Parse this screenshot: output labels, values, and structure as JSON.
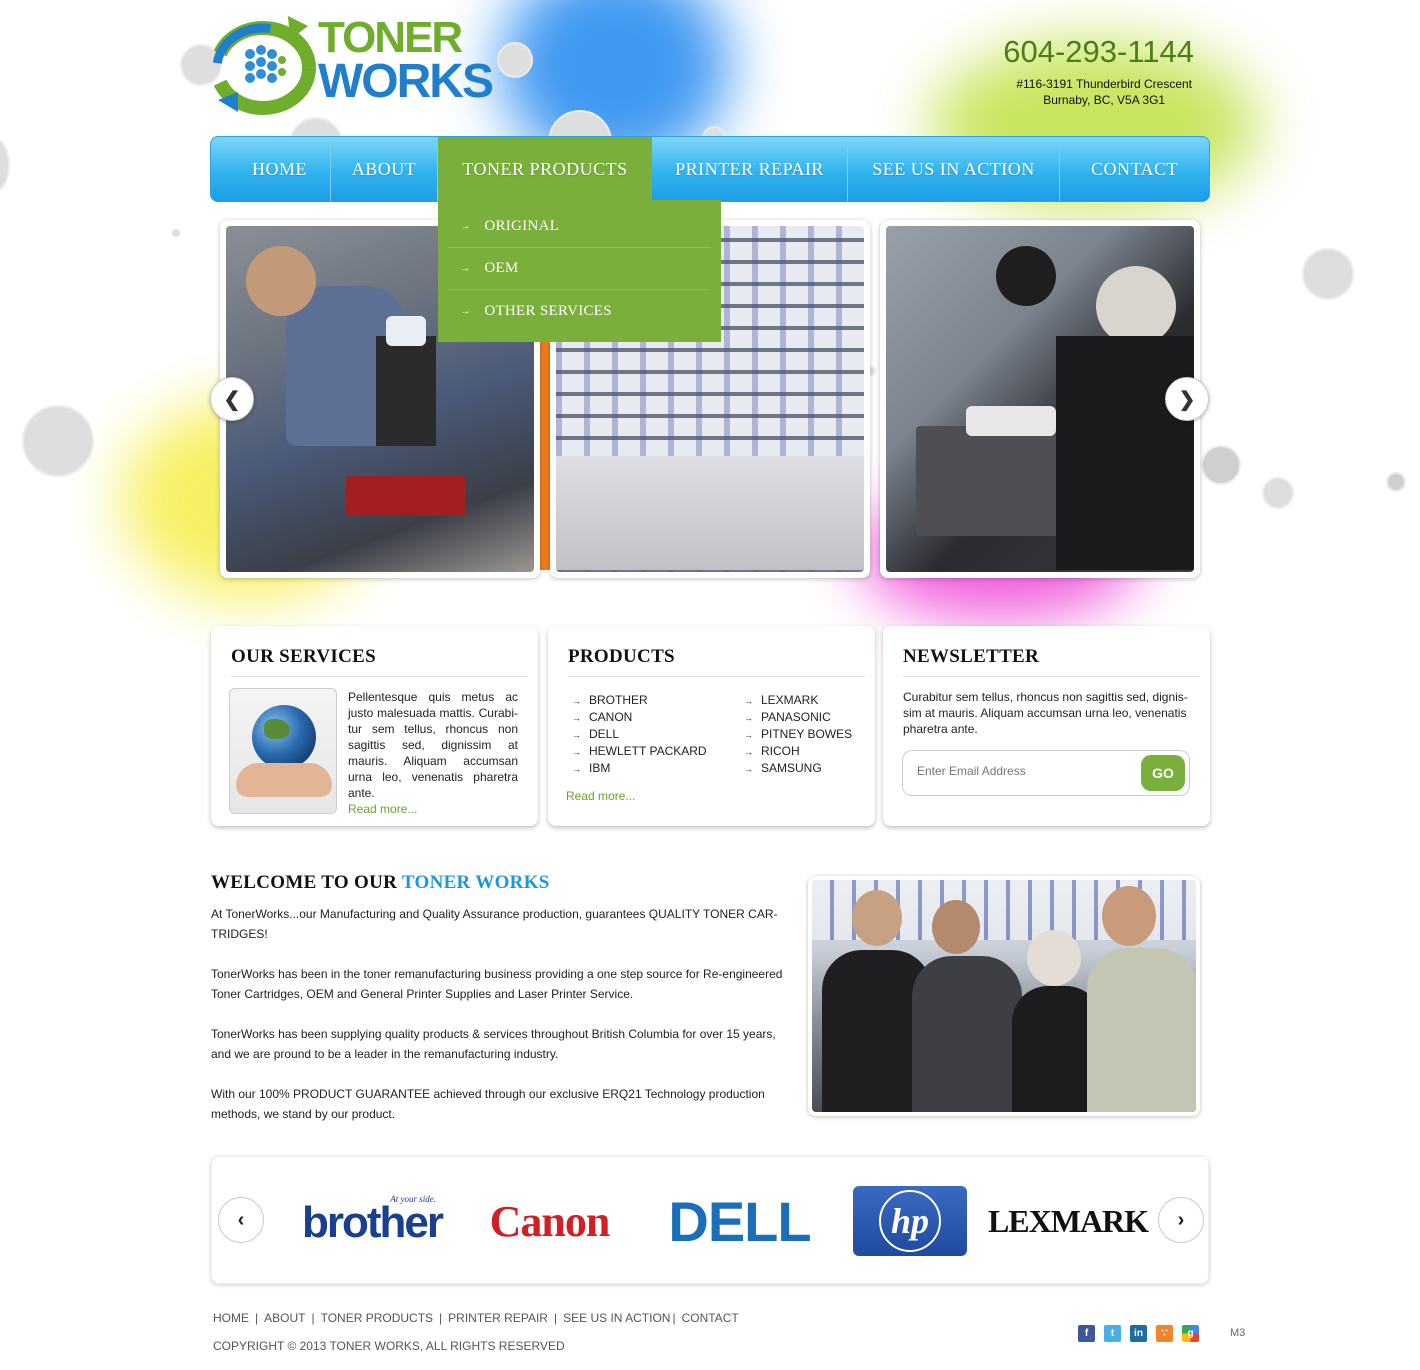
{
  "header": {
    "logo": {
      "line1": "TONER",
      "line2": "WORKS"
    },
    "phone": "604-293-1144",
    "address_line1": "#116-3191 Thunderbird Crescent",
    "address_line2": "Burnaby, BC, V5A 3G1"
  },
  "nav": {
    "items": [
      "HOME",
      "ABOUT",
      "TONER PRODUCTS",
      "PRINTER REPAIR",
      "SEE US IN ACTION",
      "CONTACT"
    ],
    "active": "TONER PRODUCTS",
    "dropdown": [
      "ORIGINAL",
      "OEM",
      "OTHER SERVICES"
    ]
  },
  "services": {
    "title": "OUR SERVICES",
    "text": "Pellentesque quis metus ac justo malesuada mattis. Curabi-tur sem tellus, rhoncus non sagittis sed, dignissim at mauris. Aliquam accumsan urna leo, venenatis pharetra ante.",
    "read_more": "Read more..."
  },
  "products": {
    "title": "PRODUCTS",
    "col1": [
      "BROTHER",
      "CANON",
      "DELL",
      "HEWLETT PACKARD",
      "IBM"
    ],
    "col2": [
      "LEXMARK",
      "PANASONIC",
      "PITNEY BOWES",
      "RICOH",
      "SAMSUNG"
    ],
    "read_more": "Read more..."
  },
  "newsletter": {
    "title": "NEWSLETTER",
    "text": "Curabitur sem tellus, rhoncus non sagittis sed, dignis-sim at mauris. Aliquam accumsan urna leo, venenatis pharetra ante.",
    "placeholder": "Enter Email Address",
    "go_label": "GO"
  },
  "welcome": {
    "title_prefix": "WELCOME TO OUR ",
    "title_highlight": "TONER WORKS",
    "p1": "At TonerWorks...our Manufacturing and Quality Assurance production, guarantees QUALITY TONER CAR-TRIDGES!",
    "p2": "TonerWorks has been in the toner remanufacturing business providing a one step source for Re-engineered Toner Cartridges, OEM and General Printer Supplies and Laser Printer Service.",
    "p3": "TonerWorks has been supplying quality products & services throughout British Columbia for over 15 years, and we are pround to be a leader in the remanufacturing industry.",
    "p4": "With our 100% PRODUCT GUARANTEE achieved through our exclusive ERQ21 Technology production methods, we stand by our product."
  },
  "brands": {
    "brother": "brother",
    "brother_tag": "At your side.",
    "canon": "Canon",
    "dell": "DELL",
    "hp": "hp",
    "lexmark": "LEXMARK"
  },
  "footer": {
    "links": [
      "HOME",
      "ABOUT",
      "TONER PRODUCTS",
      "PRINTER REPAIR",
      "SEE US IN ACTION",
      "CONTACT"
    ],
    "copyright": "COPYRIGHT © 2013 TONER WORKS, ALL RIGHTS RESERVED",
    "social": [
      "facebook-icon",
      "twitter-icon",
      "linkedin-icon",
      "rss-icon",
      "google-icon"
    ],
    "badge": "M3"
  },
  "colors": {
    "nav_blue": "#31b3ef",
    "accent_green": "#7aaf3c",
    "phone_green": "#4f7c13",
    "welcome_blue": "#1e96dc"
  }
}
